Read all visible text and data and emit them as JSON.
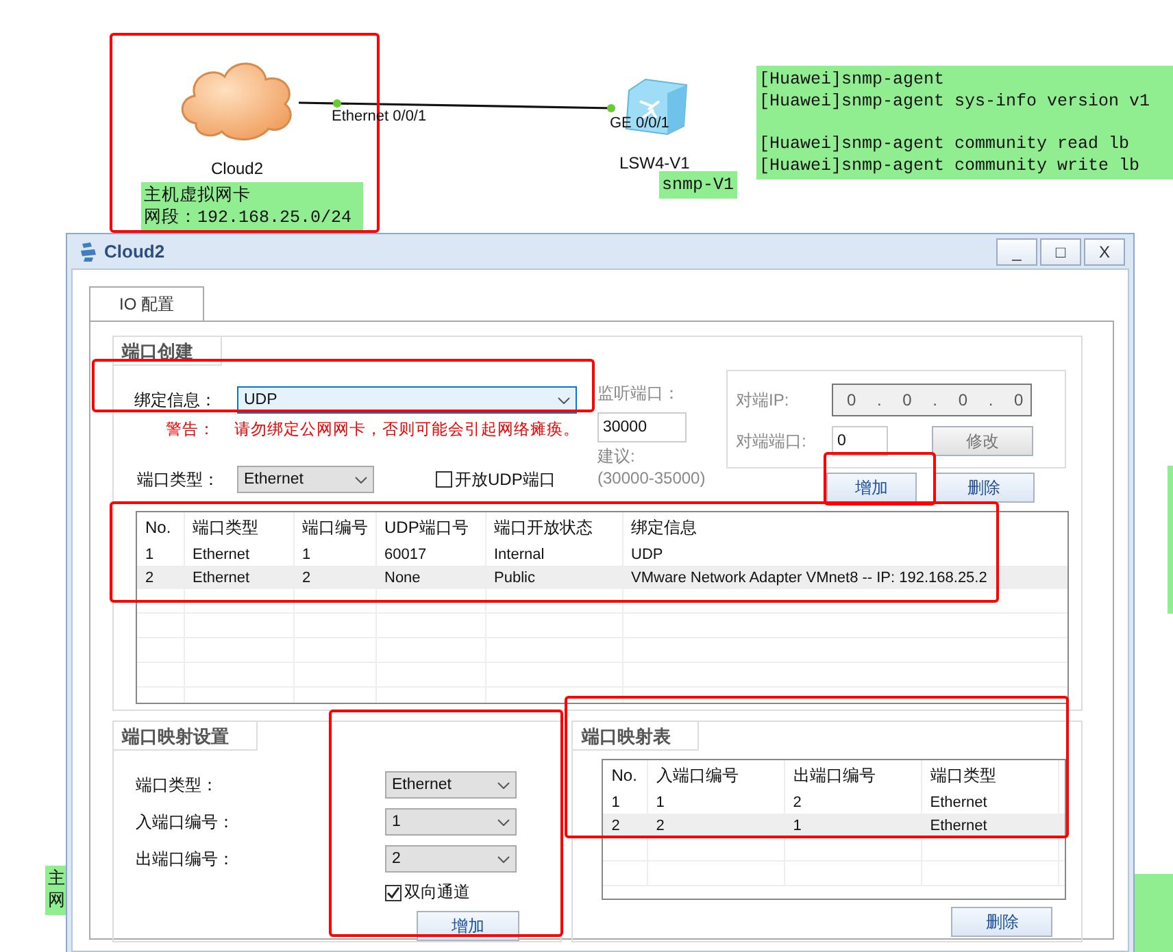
{
  "topology": {
    "nodes": [
      {
        "kind": "cloud",
        "label": "Cloud2"
      },
      {
        "kind": "switch",
        "label": "LSW4-V1"
      }
    ],
    "link": {
      "ports": [
        "Ethernet 0/0/1",
        "GE 0/0/1"
      ]
    },
    "notes": [
      {
        "paragraphs": [
          [
            "主机虚拟网卡",
            "网段：192.168.25.0/24"
          ]
        ]
      },
      {
        "paragraphs": [
          [
            "snmp-V1"
          ]
        ]
      },
      {
        "paragraphs": [
          [
            "[Huawei]snmp-agent",
            "[Huawei]snmp-agent sys-info version v1"
          ],
          [
            "[Huawei]snmp-agent community read lb",
            "[Huawei]snmp-agent community write lb"
          ]
        ]
      },
      {
        "paragraphs": [
          [
            "主",
            "网"
          ]
        ]
      }
    ]
  },
  "window": {
    "title": "Cloud2",
    "controls": [
      "_",
      "□",
      "X"
    ],
    "tabs": [
      {
        "label": "IO 配置",
        "selected": true
      }
    ],
    "port_creation": {
      "title": "端口创建",
      "binding": {
        "label": "绑定信息：",
        "value": "UDP",
        "focused": true
      },
      "warning": {
        "label": "警告：",
        "text": "请勿绑定公网网卡，否则可能会引起网络瘫痪。"
      },
      "port_type": {
        "label": "端口类型：",
        "value": "Ethernet"
      },
      "open_udp": {
        "label": "开放UDP端口",
        "checked": false
      },
      "listen_port": {
        "label": "监听端口：",
        "value": "30000",
        "hint_label": "建议:",
        "hint_range": "(30000-35000)"
      },
      "peer_ip": {
        "label": "对端IP:",
        "value": "0 . 0 . 0 . 0"
      },
      "peer_port": {
        "label": "对端端口:",
        "value": "0"
      },
      "buttons": {
        "modify": "修改",
        "add": "增加",
        "delete": "删除"
      },
      "table": {
        "columns": [
          "No.",
          "端口类型",
          "端口编号",
          "UDP端口号",
          "端口开放状态",
          "绑定信息"
        ],
        "rows": [
          [
            "1",
            "Ethernet",
            "1",
            "60017",
            "Internal",
            "UDP"
          ],
          [
            "2",
            "Ethernet",
            "2",
            "None",
            "Public",
            "VMware Network Adapter VMnet8 -- IP: 192.168.25.2"
          ]
        ]
      }
    },
    "port_mapping_settings": {
      "title": "端口映射设置",
      "fields": [
        {
          "label": "端口类型：",
          "value": "Ethernet"
        },
        {
          "label": "入端口编号：",
          "value": "1"
        },
        {
          "label": "出端口编号：",
          "value": "2"
        }
      ],
      "bidirectional": {
        "label": "双向通道",
        "checked": true
      },
      "add_button": "增加"
    },
    "port_mapping_table": {
      "title": "端口映射表",
      "columns": [
        "No.",
        "入端口编号",
        "出端口编号",
        "端口类型"
      ],
      "rows": [
        [
          "1",
          "1",
          "2",
          "Ethernet"
        ],
        [
          "2",
          "2",
          "1",
          "Ethernet"
        ]
      ],
      "delete_button": "删除"
    }
  }
}
